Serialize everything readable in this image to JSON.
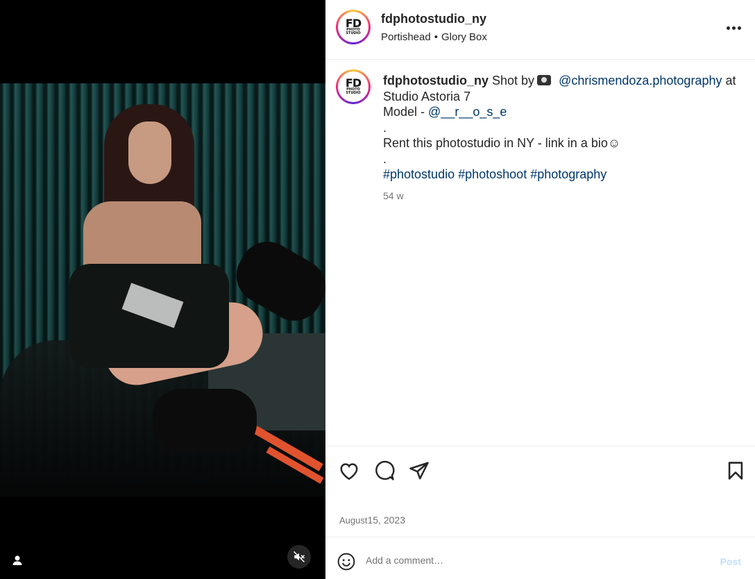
{
  "post": {
    "username": "fdphotostudio_ny",
    "avatar_text": {
      "line1": "FD",
      "line2": "PHOTO",
      "line3": "STUDIO"
    },
    "audio": {
      "artist": "Portishead",
      "separator": "•",
      "track": "Glory Box"
    }
  },
  "caption": {
    "username": "fdphotostudio_ny",
    "shot_by": "Shot by",
    "photographer": "@chrismendoza.photography",
    "at": "at",
    "location": "Studio Astoria 7",
    "model_label": "Model -",
    "model_handle": "@__r__o_s_e",
    "dot1": ".",
    "rent_text": "Rent this photostudio in NY - link in a bio☺",
    "dot2": ".",
    "hashtags": [
      "#photostudio",
      "#photoshoot",
      "#photography"
    ],
    "time_ago": "54 w"
  },
  "date": {
    "month": "August",
    "day_year": "15, 2023"
  },
  "comment": {
    "placeholder": "Add a comment…",
    "post_label": "Post"
  },
  "icons": {
    "heart": "heart-icon",
    "comment": "comment-icon",
    "share": "share-icon",
    "save": "bookmark-icon",
    "more": "more-icon",
    "emoji": "emoji-icon",
    "user_tag": "user-tag-icon",
    "mute": "muted-audio-icon"
  },
  "colors": {
    "link": "#00376b",
    "post_disabled": "#c0dffd",
    "muted_text": "#737373"
  }
}
